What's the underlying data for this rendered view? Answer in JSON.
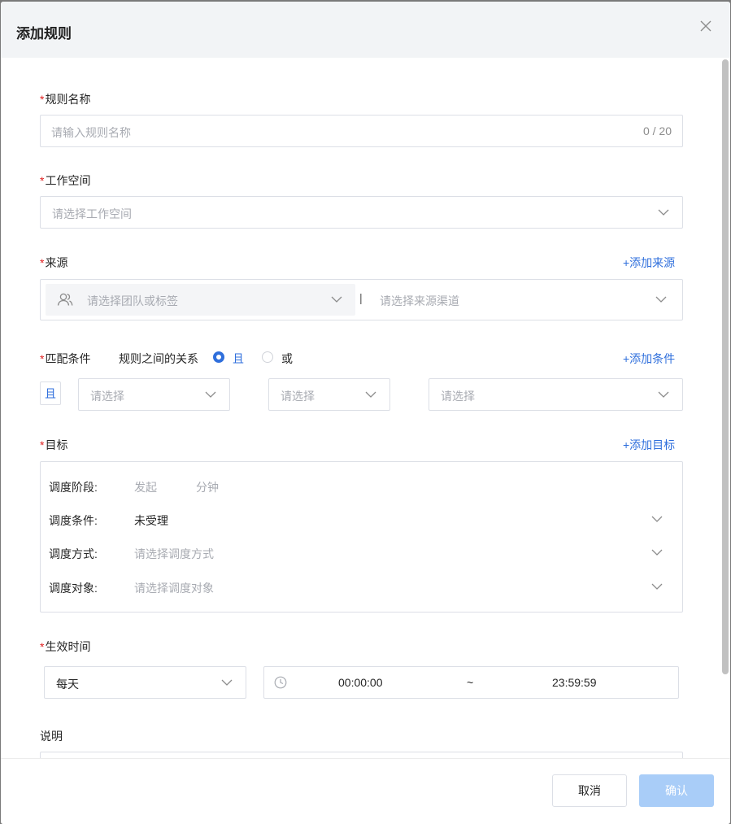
{
  "dialog": {
    "title": "添加规则"
  },
  "rule_name": {
    "label": "规则名称",
    "placeholder": "请输入规则名称",
    "counter": "0 / 20"
  },
  "workspace": {
    "label": "工作空间",
    "placeholder": "请选择工作空间"
  },
  "source": {
    "label": "来源",
    "add_link": "+添加来源",
    "team_placeholder": "请选择团队或标签",
    "separator": "|",
    "channel_placeholder": "请选择来源渠道"
  },
  "match": {
    "label": "匹配条件",
    "relation_label": "规则之间的关系",
    "option_and": "且",
    "option_or": "或",
    "selected": "且",
    "add_link": "+添加条件",
    "row_tag": "且",
    "select1_placeholder": "请选择",
    "select2_placeholder": "请选择",
    "select3_placeholder": "请选择"
  },
  "target": {
    "label": "目标",
    "add_link": "+添加目标",
    "stage_label": "调度阶段:",
    "stage_value1": "发起",
    "stage_value2": "分钟",
    "condition_label": "调度条件:",
    "condition_value": "未受理",
    "method_label": "调度方式:",
    "method_placeholder": "请选择调度方式",
    "object_label": "调度对象:",
    "object_placeholder": "请选择调度对象"
  },
  "effective": {
    "label": "生效时间",
    "frequency": "每天",
    "start_time": "00:00:00",
    "range_sep": "~",
    "end_time": "23:59:59"
  },
  "description": {
    "label": "说明"
  },
  "footer": {
    "cancel": "取消",
    "confirm": "确认"
  },
  "colors": {
    "accent": "#2f6fdc",
    "required": "#e02020",
    "confirm_disabled": "#a9cdf8",
    "header_bg": "#f2f4f6"
  },
  "icons": {
    "close": "close-icon",
    "chevron": "chevron-down-icon",
    "team": "users-icon",
    "clock": "clock-icon"
  }
}
